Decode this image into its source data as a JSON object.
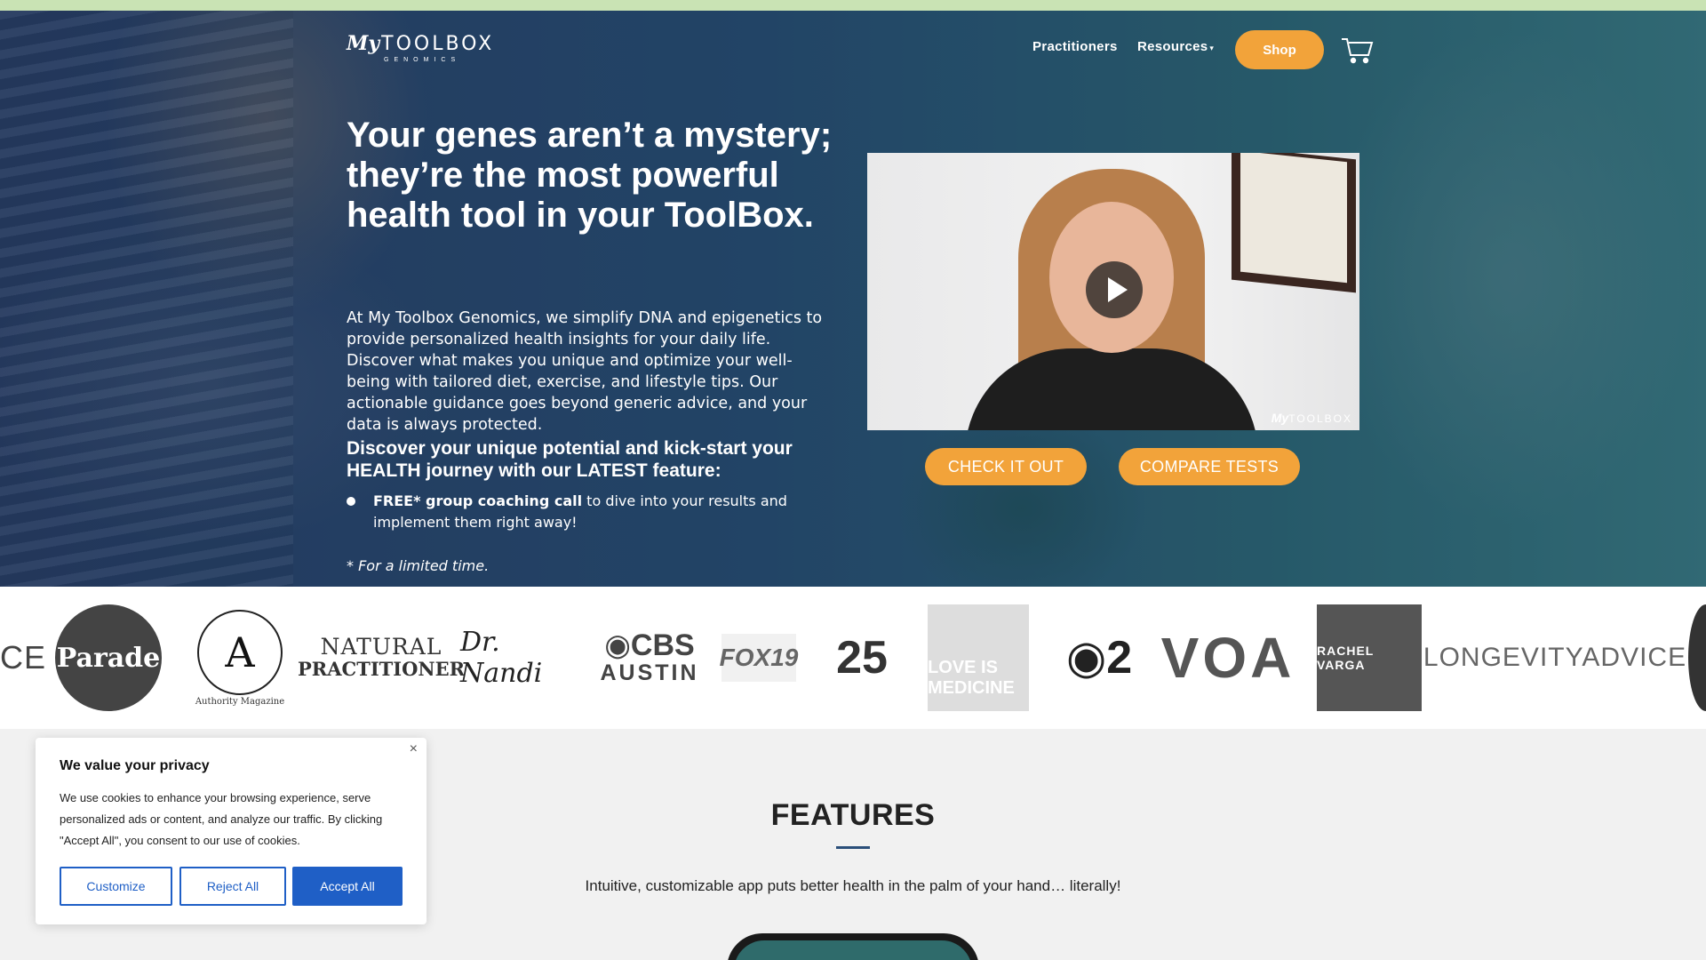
{
  "header": {
    "logo_my": "My",
    "logo_toolbox": "TOOLBOX",
    "logo_genomics": "GENOMICS",
    "nav": [
      {
        "label": "Practitioners"
      },
      {
        "label": "Resources"
      }
    ],
    "shop_label": "Shop",
    "cart_icon": "shopping-cart-icon"
  },
  "hero": {
    "headline": "Your genes aren’t a mystery; they’re the most powerful health tool in your ToolBox.",
    "intro": "At My Toolbox Genomics, we simplify DNA and epigenetics to provide personalized health insights for your daily life. Discover what makes you unique and optimize your well-being with tailored diet, exercise, and lifestyle tips. Our actionable guidance goes beyond generic advice, and your data is always protected.",
    "subhead": "Discover your unique potential and kick-start your HEALTH journey with our LATEST feature:",
    "bullet_bold": "FREE* group coaching call",
    "bullet_rest": " to dive into your results and implement them right away!",
    "limited": "* For a limited time.",
    "video_watermark_my": "My",
    "video_watermark_toolbox": "TOOLBOX",
    "cta_primary": "CHECK IT OUT",
    "cta_secondary": "COMPARE TESTS"
  },
  "press_logos": {
    "ce": "CE",
    "parade": "Parade",
    "authority_letter": "A",
    "authority_caption": "Authority Magazine",
    "natural_a": "NATURAL",
    "natural_b": "PRACTITIONER",
    "nandi": "Dr. Nandi",
    "cbs_a": "◉CBS",
    "cbs_b": "AUSTIN",
    "fox": "FOX19",
    "abc25": "25",
    "love": "LOVE IS MEDICINE",
    "kutv": "◉2",
    "voa": "VOA",
    "rachel": "RACHEL VARGA",
    "longevity": "LONGEVITYADVICE"
  },
  "features": {
    "title": "FEATURES",
    "subtitle": "Intuitive, customizable app puts better health in the palm of your hand… literally!"
  },
  "cookie_banner": {
    "title": "We value your privacy",
    "body": "We use cookies to enhance your browsing experience, serve personalized ads or content, and analyze our traffic. By clicking \"Accept All\", you consent to our use of cookies.",
    "customize": "Customize",
    "reject": "Reject All",
    "accept": "Accept All",
    "close": "×"
  },
  "colors": {
    "accent_orange": "#f2a33a",
    "cookie_blue": "#1f5fc6",
    "feature_rule": "#2b4f7a"
  }
}
